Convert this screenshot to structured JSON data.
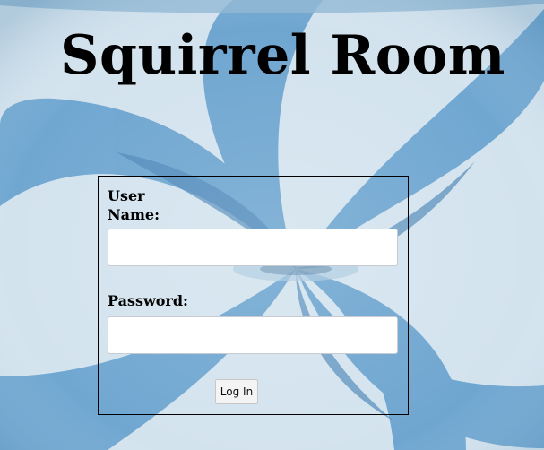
{
  "page": {
    "title": "Squirrel Room"
  },
  "login_form": {
    "username_label": "User Name:",
    "username_value": "",
    "password_label": "Password:",
    "password_value": "",
    "submit_label": "Log In"
  },
  "colors": {
    "background_light": "#d6e6ef",
    "background_blue": "#5b98c8",
    "border": "#000000",
    "button_bg": "#f4f4f4"
  }
}
